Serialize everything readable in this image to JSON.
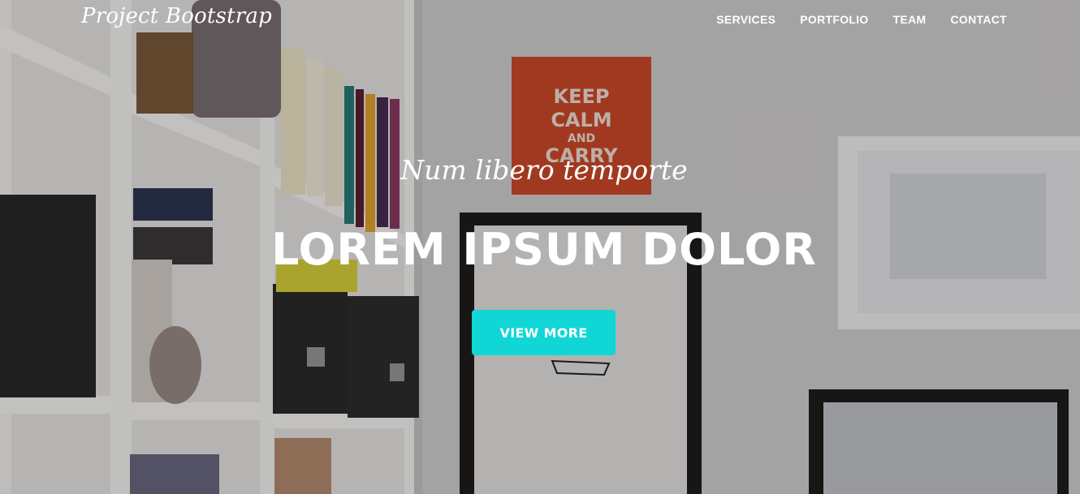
{
  "navbar": {
    "brand": "Project Bootstrap",
    "links": [
      "SERVICES",
      "PORTFOLIO",
      "TEAM",
      "CONTACT"
    ]
  },
  "hero": {
    "subheading": "Num libero temporte",
    "heading": "LOREM IPSUM DOLOR",
    "button_label": "VIEW MORE",
    "button_color": "#11d6d6",
    "poster_text": [
      "KEEP",
      "CALM",
      "AND",
      "CARRY"
    ],
    "poster_color": "#cf4a2a"
  }
}
